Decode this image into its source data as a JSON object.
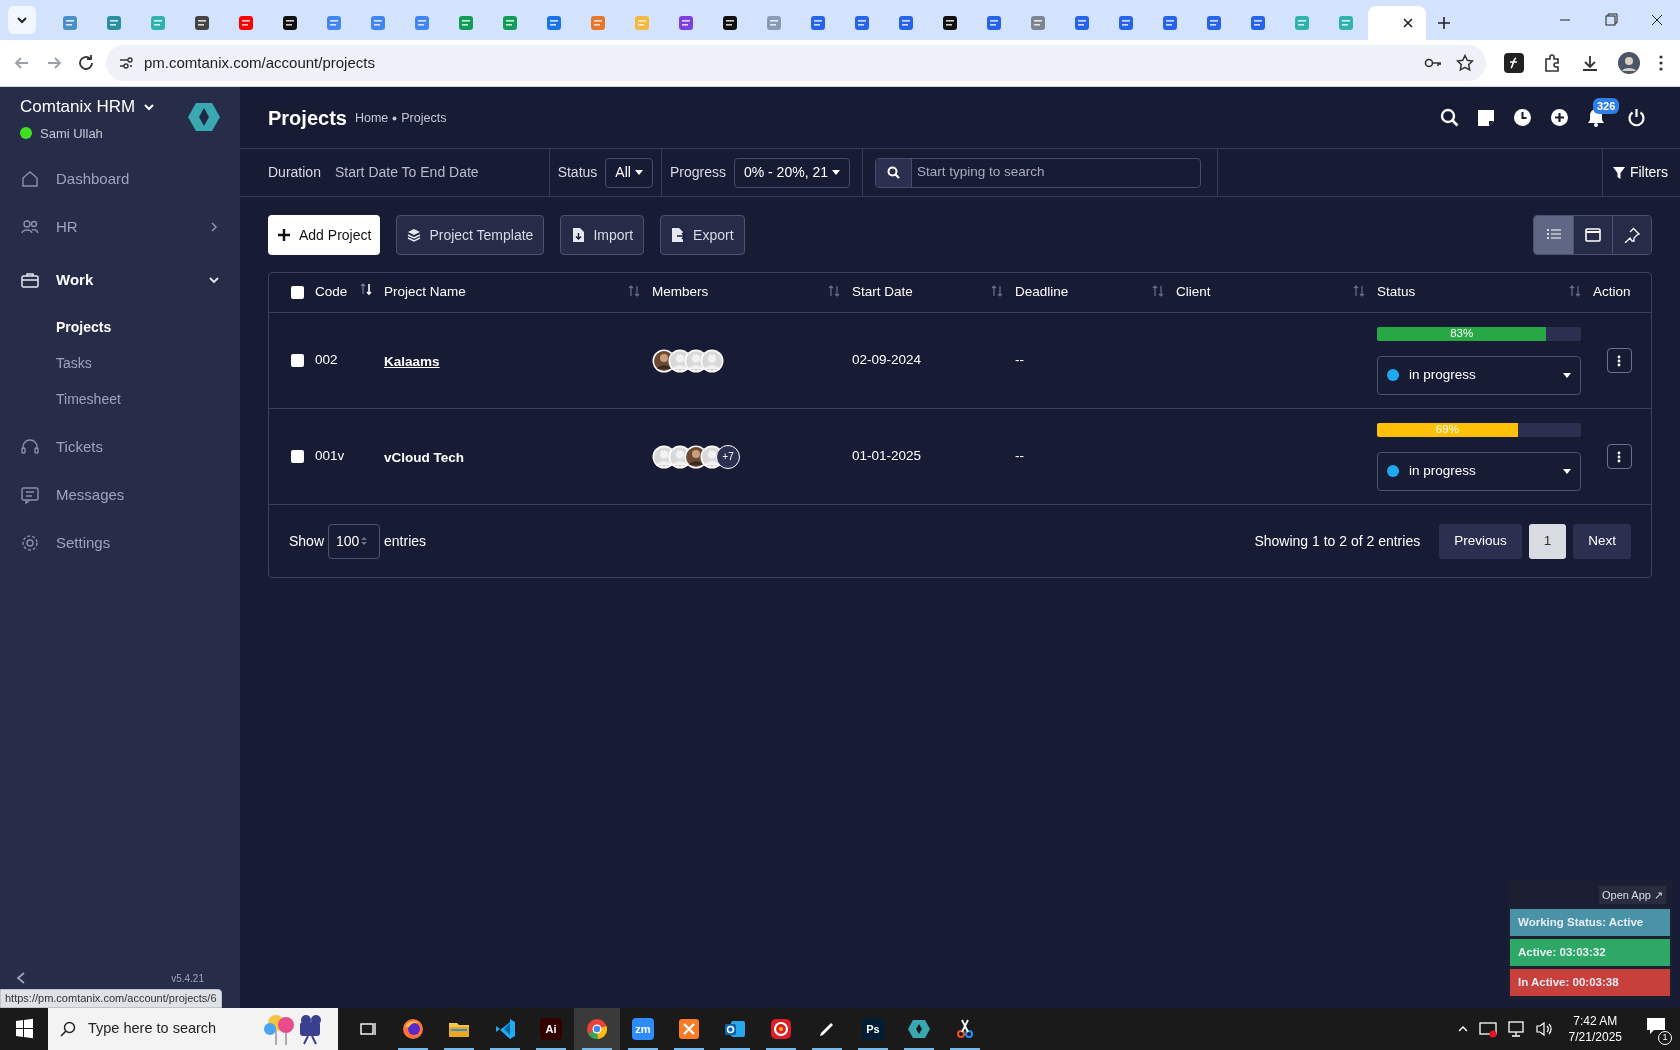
{
  "browser": {
    "tabs": [
      {
        "color": "#4a90c8",
        "selected": false
      },
      {
        "color": "#2a8fa0",
        "selected": false
      },
      {
        "color": "#2fb3b0",
        "selected": false
      },
      {
        "color": "#444444",
        "selected": false
      },
      {
        "color": "#ff0000",
        "selected": false
      },
      {
        "color": "#111111",
        "selected": false
      },
      {
        "color": "#4285f4",
        "selected": false
      },
      {
        "color": "#4285f4",
        "selected": false
      },
      {
        "color": "#4285f4",
        "selected": false
      },
      {
        "color": "#0f9d58",
        "selected": false
      },
      {
        "color": "#0f9d58",
        "selected": false
      },
      {
        "color": "#1a73e8",
        "selected": false
      },
      {
        "color": "#e8762b",
        "selected": false
      },
      {
        "color": "#f5b83d",
        "selected": false
      },
      {
        "color": "#7b3fe4",
        "selected": false
      },
      {
        "color": "#111111",
        "selected": false
      },
      {
        "color": "#8a9bb8",
        "selected": false
      },
      {
        "color": "#2563eb",
        "selected": false
      },
      {
        "color": "#2563eb",
        "selected": false
      },
      {
        "color": "#2563eb",
        "selected": false
      },
      {
        "color": "#111111",
        "selected": false
      },
      {
        "color": "#2563eb",
        "selected": false
      },
      {
        "color": "#7d8590",
        "selected": false
      },
      {
        "color": "#2563eb",
        "selected": false
      },
      {
        "color": "#2563eb",
        "selected": false
      },
      {
        "color": "#2563eb",
        "selected": false
      },
      {
        "color": "#2563eb",
        "selected": false
      },
      {
        "color": "#2563eb",
        "selected": false
      },
      {
        "color": "#2fb3b0",
        "selected": false
      },
      {
        "color": "#2fb3b0",
        "selected": false
      },
      {
        "selected": true
      }
    ],
    "url": "pm.comtanix.com/account/projects",
    "link_preview": "https://pm.comtanix.com/account/projects/6"
  },
  "sidebar": {
    "brand": "Comtanix HRM",
    "user": "Sami Ullah",
    "user_online": true,
    "items": [
      {
        "label": "Dashboard",
        "selected": false
      },
      {
        "label": "HR",
        "selected": false,
        "expanded": false
      },
      {
        "label": "Work",
        "selected": true,
        "expanded": true,
        "children": [
          {
            "label": "Projects",
            "selected": true
          },
          {
            "label": "Tasks",
            "selected": false
          },
          {
            "label": "Timesheet",
            "selected": false
          }
        ]
      },
      {
        "label": "Tickets",
        "selected": false
      },
      {
        "label": "Messages",
        "selected": false
      },
      {
        "label": "Settings",
        "selected": false
      }
    ],
    "version": "v5.4.21"
  },
  "header": {
    "title": "Projects",
    "breadcrumb": [
      "Home",
      "Projects"
    ],
    "notification_count": "326"
  },
  "filters": {
    "duration_label": "Duration",
    "duration_value": "Start Date To End Date",
    "status_label": "Status",
    "status_value": "All",
    "progress_label": "Progress",
    "progress_value": "0% - 20%, 21",
    "search_placeholder": "Start typing to search",
    "filters_button": "Filters"
  },
  "actions": [
    "Add Project",
    "Project Template",
    "Import",
    "Export"
  ],
  "views": [
    {
      "kind": "list",
      "selected": true
    },
    {
      "kind": "calendar",
      "selected": false
    },
    {
      "kind": "pin",
      "selected": false
    }
  ],
  "table": {
    "all_checked": false,
    "columns": [
      {
        "label": "Code",
        "sortable": true,
        "sorted": true
      },
      {
        "label": "Project Name",
        "sortable": true,
        "sorted": false
      },
      {
        "label": "Members",
        "sortable": true,
        "sorted": false
      },
      {
        "label": "Start Date",
        "sortable": true,
        "sorted": false
      },
      {
        "label": "Deadline",
        "sortable": true,
        "sorted": false
      },
      {
        "label": "Client",
        "sortable": true,
        "sorted": false
      },
      {
        "label": "Status",
        "sortable": true,
        "sorted": false
      },
      {
        "label": "Action",
        "sortable": false
      }
    ],
    "rows": [
      {
        "checked": false,
        "code": "002",
        "name": "Kalaams",
        "name_link": true,
        "members": [
          {
            "kind": "photo"
          },
          {
            "kind": "blank"
          },
          {
            "kind": "blank"
          },
          {
            "kind": "blank"
          }
        ],
        "start": "02-09-2024",
        "deadline": "--",
        "progress": {
          "level": 0.83,
          "label": "83%",
          "color": "#28a745"
        },
        "status": {
          "label": "in progress",
          "color": "#1eaaf1"
        }
      },
      {
        "checked": false,
        "code": "001v",
        "name": "vCloud Tech",
        "name_link": false,
        "members": [
          {
            "kind": "blank"
          },
          {
            "kind": "blank"
          },
          {
            "kind": "photo"
          },
          {
            "kind": "blank"
          }
        ],
        "more": "+7",
        "start": "01-01-2025",
        "deadline": "--",
        "progress": {
          "level": 0.69,
          "label": "69%",
          "color": "#ffc107"
        },
        "status": {
          "label": "in progress",
          "color": "#1eaaf1"
        }
      }
    ],
    "show_label": "Show",
    "page_size": "100",
    "entries_label": "entries",
    "summary": "Showing 1 to 2 of 2 entries",
    "pager": [
      {
        "label": "Previous",
        "selected": false
      },
      {
        "label": "1",
        "selected": true
      },
      {
        "label": "Next",
        "selected": false
      }
    ]
  },
  "tracker": {
    "open_app": "Open App ↗",
    "lines": [
      {
        "text": "Working Status: Active",
        "color": "#4a93a6"
      },
      {
        "text": "Active: 03:03:32",
        "color": "#2ea866"
      },
      {
        "text": "In Active: 00:03:38",
        "color": "#c8403b"
      }
    ]
  },
  "taskbar": {
    "search_placeholder": "Type here to search",
    "apps": [
      {
        "kind": "taskview"
      },
      {
        "kind": "firefox"
      },
      {
        "kind": "folder"
      },
      {
        "kind": "vscode"
      },
      {
        "kind": "tile",
        "text": "Ai",
        "color": "#330000"
      },
      {
        "kind": "chrome",
        "selected": true
      },
      {
        "kind": "tile",
        "text": "zm",
        "color": "#2d8cff"
      },
      {
        "kind": "xampp"
      },
      {
        "kind": "outlook"
      },
      {
        "kind": "cloud"
      },
      {
        "kind": "pen"
      },
      {
        "kind": "tile",
        "text": "Ps",
        "color": "#001e36"
      },
      {
        "kind": "hex"
      },
      {
        "kind": "snip"
      }
    ],
    "time": "7:42 AM",
    "date": "7/21/2025",
    "notifications": "1"
  }
}
